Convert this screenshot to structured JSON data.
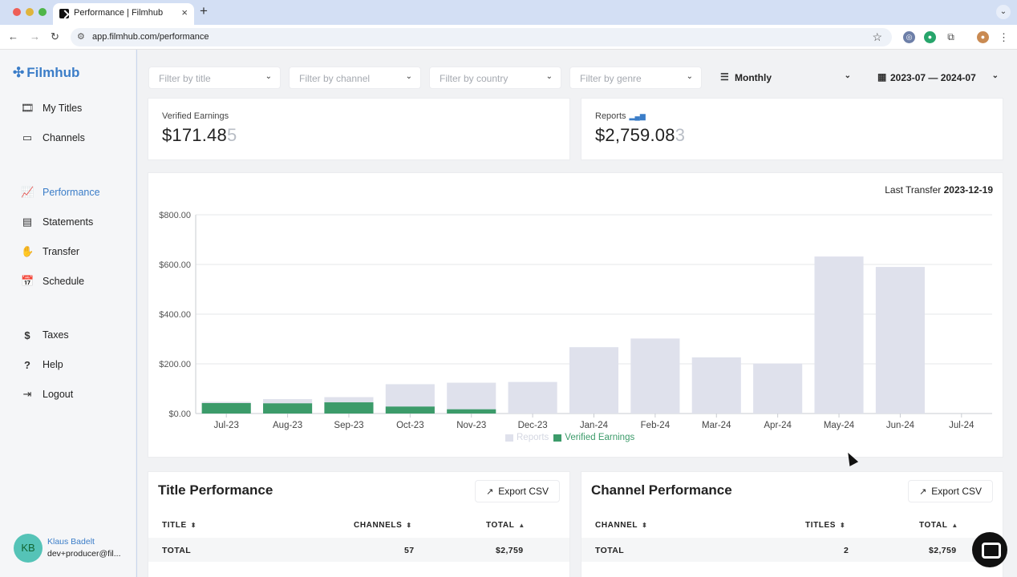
{
  "browser": {
    "tab_title": "Performance | Filmhub",
    "tab_close": "×",
    "new_tab": "+",
    "url": "app.filmhub.com/performance",
    "tab_menu": "⌄"
  },
  "sidebar": {
    "logo": "Filmhub",
    "items": [
      {
        "label": "My Titles",
        "icon": "film-icon"
      },
      {
        "label": "Channels",
        "icon": "monitor-icon"
      },
      {
        "label": "Performance",
        "icon": "chart-icon",
        "active": true
      },
      {
        "label": "Statements",
        "icon": "document-icon"
      },
      {
        "label": "Transfer",
        "icon": "hand-money-icon"
      },
      {
        "label": "Schedule",
        "icon": "calendar-icon"
      },
      {
        "label": "Taxes",
        "icon": "dollar-icon"
      },
      {
        "label": "Help",
        "icon": "question-icon"
      },
      {
        "label": "Logout",
        "icon": "logout-icon"
      }
    ],
    "user": {
      "initials": "KB",
      "name": "Klaus Badelt",
      "email": "dev+producer@fil..."
    }
  },
  "filters": {
    "title_placeholder": "Filter by title",
    "channel_placeholder": "Filter by channel",
    "country_placeholder": "Filter by country",
    "genre_placeholder": "Filter by genre",
    "period": "Monthly",
    "date_range": "2023-07 — 2024-07"
  },
  "stats": {
    "verified": {
      "label": "Verified Earnings",
      "value": "$171.48",
      "value_dim": "5"
    },
    "reports": {
      "label": "Reports",
      "value": "$2,759.08",
      "value_dim": "3"
    }
  },
  "chart": {
    "last_transfer_label": "Last Transfer",
    "last_transfer_date": "2023-12-19"
  },
  "chart_data": {
    "type": "bar",
    "categories": [
      "Jul-23",
      "Aug-23",
      "Sep-23",
      "Oct-23",
      "Nov-23",
      "Dec-23",
      "Jan-24",
      "Feb-24",
      "Mar-24",
      "Apr-24",
      "May-24",
      "Jun-24",
      "Jul-24"
    ],
    "series": [
      {
        "name": "Reports",
        "values": [
          47,
          58,
          66,
          118,
          124,
          127,
          267,
          302,
          226,
          201,
          632,
          590,
          0
        ],
        "color": "#dfe1ec"
      },
      {
        "name": "Verified Earnings",
        "values": [
          42,
          41,
          45,
          28,
          17,
          0,
          0,
          0,
          0,
          0,
          0,
          0,
          0
        ],
        "color": "#3c9b6a"
      }
    ],
    "yticks": [
      "$0.00",
      "$200.00",
      "$400.00",
      "$600.00",
      "$800.00"
    ],
    "ylim": [
      0,
      800
    ],
    "grid": true,
    "legend": "bottom-center",
    "stacked": "overlay"
  },
  "title_performance": {
    "title": "Title Performance",
    "export": "Export CSV",
    "columns": [
      "TITLE",
      "CHANNELS",
      "TOTAL"
    ],
    "total_row": {
      "label": "TOTAL",
      "channels": "57",
      "total": "$2,759"
    }
  },
  "channel_performance": {
    "title": "Channel Performance",
    "export": "Export CSV",
    "columns": [
      "CHANNEL",
      "TITLES",
      "TOTAL"
    ],
    "total_row": {
      "label": "TOTAL",
      "titles": "2",
      "total": "$2,759"
    }
  }
}
